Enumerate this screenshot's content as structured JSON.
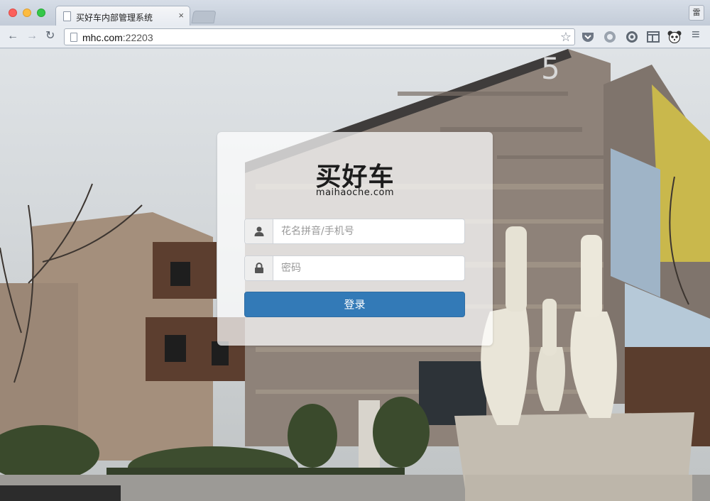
{
  "browser": {
    "tab_title": "买好车内部管理系统",
    "tab_close": "×",
    "profile_label": "雷",
    "url_host": "mhc.com",
    "url_port": ":22203",
    "nav_back": "←",
    "nav_forward": "→",
    "nav_reload": "↻",
    "star": "☆",
    "extension_icons": [
      "pocket-icon",
      "circle-icon",
      "firefox-icon",
      "layout-icon",
      "panda-icon"
    ],
    "menu": "≡"
  },
  "background": {
    "building_number": "5"
  },
  "login": {
    "logo_cn": "买好车",
    "logo_en": "maihaoche.com",
    "username_placeholder": "花名拼音/手机号",
    "password_placeholder": "密码",
    "submit_label": "登录",
    "accent": "#337ab7"
  }
}
